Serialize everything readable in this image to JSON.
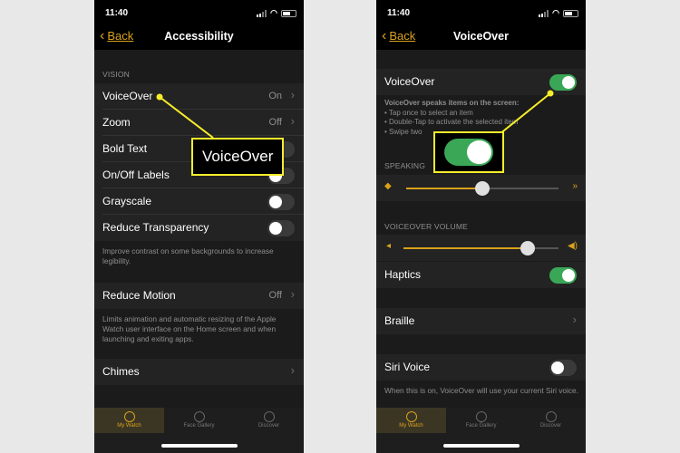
{
  "colors": {
    "accent": "#d9a21c",
    "toggle_on": "#3aa757",
    "callout": "#f7ee2a"
  },
  "left": {
    "status": {
      "time": "11:40",
      "icons": [
        "location-icon",
        "signal-icon",
        "wifi-icon",
        "battery-icon"
      ]
    },
    "nav": {
      "back": "Back",
      "title": "Accessibility"
    },
    "section_vision": "VISION",
    "rows": {
      "voiceover": {
        "label": "VoiceOver",
        "value": "On"
      },
      "zoom": {
        "label": "Zoom",
        "value": "Off"
      },
      "bold_text": {
        "label": "Bold Text",
        "toggle": false
      },
      "onoff_labels": {
        "label": "On/Off Labels",
        "toggle": false
      },
      "grayscale": {
        "label": "Grayscale",
        "toggle": false
      },
      "reduce_transparency": {
        "label": "Reduce Transparency",
        "toggle": false
      }
    },
    "transparency_footer": "Improve contrast on some backgrounds to increase legibility.",
    "reduce_motion": {
      "label": "Reduce Motion",
      "value": "Off"
    },
    "motion_footer": "Limits animation and automatic resizing of the Apple Watch user interface on the Home screen and when launching and exiting apps.",
    "chimes": {
      "label": "Chimes"
    },
    "callout": "VoiceOver",
    "tabs": [
      "My Watch",
      "Face Gallery",
      "Discover"
    ]
  },
  "right": {
    "status": {
      "time": "11:40",
      "icons": [
        "location-icon",
        "signal-icon",
        "wifi-icon",
        "battery-icon"
      ]
    },
    "nav": {
      "back": "Back",
      "title": "VoiceOver"
    },
    "voiceover": {
      "label": "VoiceOver",
      "toggle": true
    },
    "description_title": "VoiceOver speaks items on the screen:",
    "description_items": [
      "• Tap once to select an item",
      "• Double-Tap to activate the selected item",
      "• Swipe two"
    ],
    "section_speaking": "SPEAKING",
    "speaking_rate": 0.5,
    "section_volume": "VOICEOVER VOLUME",
    "volume": 0.8,
    "haptics": {
      "label": "Haptics",
      "toggle": true
    },
    "braille": {
      "label": "Braille"
    },
    "siri_voice": {
      "label": "Siri Voice",
      "toggle": false
    },
    "siri_footer": "When this is on, VoiceOver will use your current Siri voice.",
    "tabs": [
      "My Watch",
      "Face Gallery",
      "Discover"
    ]
  }
}
